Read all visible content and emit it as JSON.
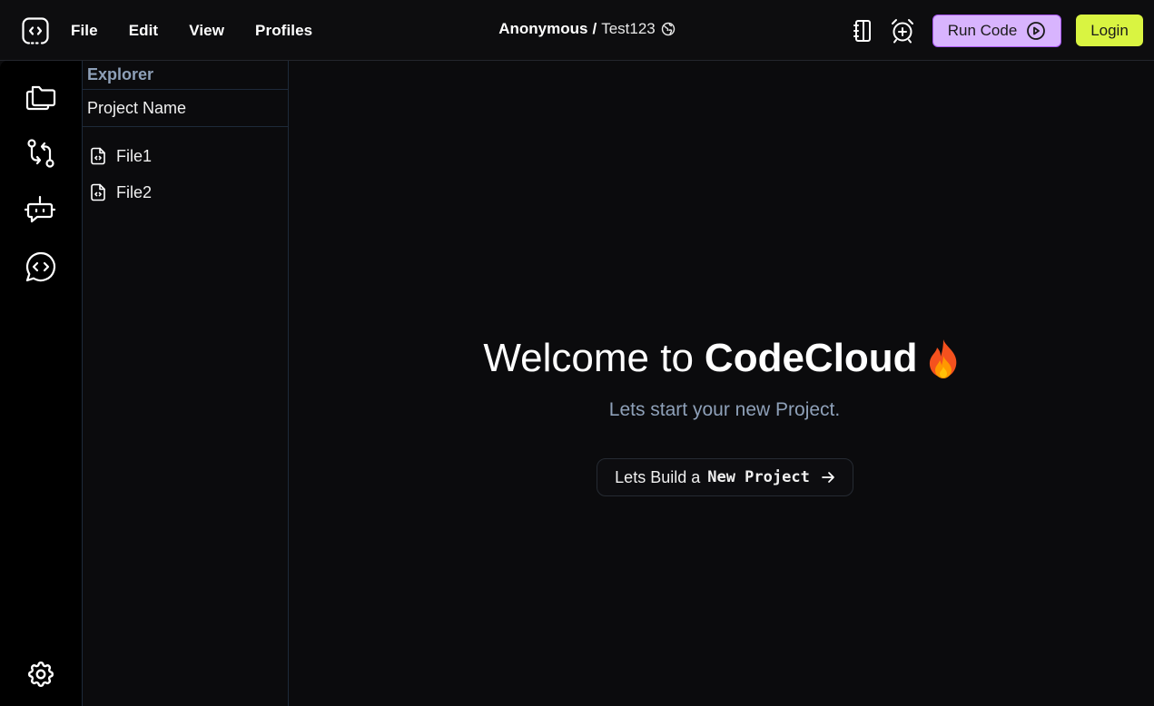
{
  "menu": {
    "items": [
      "File",
      "Edit",
      "View",
      "Profiles"
    ]
  },
  "breadcrumb": {
    "owner": "Anonymous",
    "separator": "/",
    "project": "Test123"
  },
  "toolbar": {
    "run_label": "Run Code",
    "login_label": "Login"
  },
  "explorer": {
    "title": "Explorer",
    "project_name": "Project Name",
    "files": [
      "File1",
      "File2"
    ]
  },
  "welcome": {
    "prefix": "Welcome to",
    "brand": "CodeCloud",
    "subtitle": "Lets start your new Project.",
    "cta_prefix": "Lets Build a",
    "cta_bold": "New Project"
  },
  "icons": {
    "logo": "code-bracket-icon",
    "notebook": "notebook-icon",
    "alarm": "alarm-plus-icon",
    "run": "play-circle-icon",
    "globe": "globe-icon",
    "activity": [
      "folders-icon",
      "git-compare-icon",
      "bot-icon",
      "code-chat-icon",
      "gear-icon"
    ],
    "file": "file-code-icon",
    "fire": "fire-icon",
    "arrow": "arrow-right-icon"
  },
  "colors": {
    "background": "#0b0b0d",
    "run_button": "#d8b4fe",
    "login_button": "#d9f441",
    "muted_text": "#8ea0b8"
  }
}
